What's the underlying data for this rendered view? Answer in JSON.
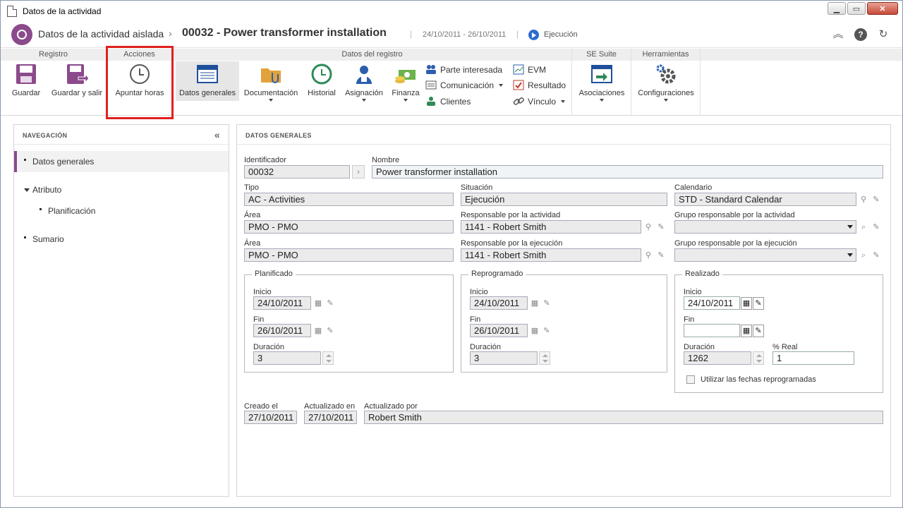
{
  "window": {
    "title": "Datos de la actividad"
  },
  "header": {
    "module": "Datos de la actividad aislada",
    "separator": "›",
    "record": "00032 - Power transformer installation",
    "dates": "24/10/2011 - 26/10/2011",
    "status": "Ejecución"
  },
  "ribbon": {
    "groups": {
      "registro": "Registro",
      "acciones": "Acciones",
      "datos": "Datos del registro",
      "suite": "SE Suite",
      "herramientas": "Herramientas"
    },
    "buttons": {
      "guardar": "Guardar",
      "guardar_salir": "Guardar y salir",
      "apuntar": "Apuntar horas",
      "datos_generales": "Datos generales",
      "documentacion": "Documentación",
      "historial": "Historial",
      "asignacion": "Asignación",
      "finanza": "Finanza",
      "parte": "Parte interesada",
      "comunicacion": "Comunicación",
      "clientes": "Clientes",
      "evm": "EVM",
      "resultado": "Resultado",
      "vinculo": "Vínculo",
      "asociaciones": "Asociaciones",
      "configuraciones": "Configuraciones"
    }
  },
  "nav": {
    "title": "NAVEGACIÓN",
    "collapse": "«",
    "items": [
      "Datos generales",
      "Atributo",
      "Planificación",
      "Sumario"
    ]
  },
  "form": {
    "title": "DATOS GENERALES",
    "identificador": {
      "label": "Identificador",
      "value": "00032"
    },
    "nombre": {
      "label": "Nombre",
      "value": "Power transformer installation"
    },
    "tipo": {
      "label": "Tipo",
      "value": "AC - Activities"
    },
    "situacion": {
      "label": "Situación",
      "value": "Ejecución"
    },
    "calendario": {
      "label": "Calendario",
      "value": "STD - Standard Calendar"
    },
    "area1": {
      "label": "Área",
      "value": "PMO - PMO"
    },
    "resp_actividad": {
      "label": "Responsable por la actividad",
      "value": "1141 - Robert Smith"
    },
    "grupo_actividad": {
      "label": "Grupo responsable por la actividad",
      "value": ""
    },
    "area2": {
      "label": "Área",
      "value": "PMO - PMO"
    },
    "resp_ejecucion": {
      "label": "Responsable por la ejecución",
      "value": "1141 - Robert Smith"
    },
    "grupo_ejecucion": {
      "label": "Grupo responsable por la ejecución",
      "value": ""
    },
    "planificado": {
      "title": "Planificado",
      "inicio_label": "Inicio",
      "inicio": "24/10/2011",
      "fin_label": "Fin",
      "fin": "26/10/2011",
      "duracion_label": "Duración",
      "duracion": "3"
    },
    "reprogramado": {
      "title": "Reprogramado",
      "inicio_label": "Inicio",
      "inicio": "24/10/2011",
      "fin_label": "Fin",
      "fin": "26/10/2011",
      "duracion_label": "Duración",
      "duracion": "3"
    },
    "realizado": {
      "title": "Realizado",
      "inicio_label": "Inicio",
      "inicio": "24/10/2011",
      "fin_label": "Fin",
      "fin": "",
      "duracion_label": "Duración",
      "duracion": "1262",
      "real_label": "% Real",
      "real": "1",
      "checkbox_label": "Utilizar las fechas reprogramadas"
    },
    "creado": {
      "label": "Creado el",
      "value": "27/10/2011"
    },
    "actualizado_en": {
      "label": "Actualizado en",
      "value": "27/10/2011"
    },
    "actualizado_por": {
      "label": "Actualizado por",
      "value": "Robert Smith"
    }
  },
  "colors": {
    "accent": "#8b4a8c",
    "highlight": "#e02020",
    "play": "#2d6bd3"
  }
}
